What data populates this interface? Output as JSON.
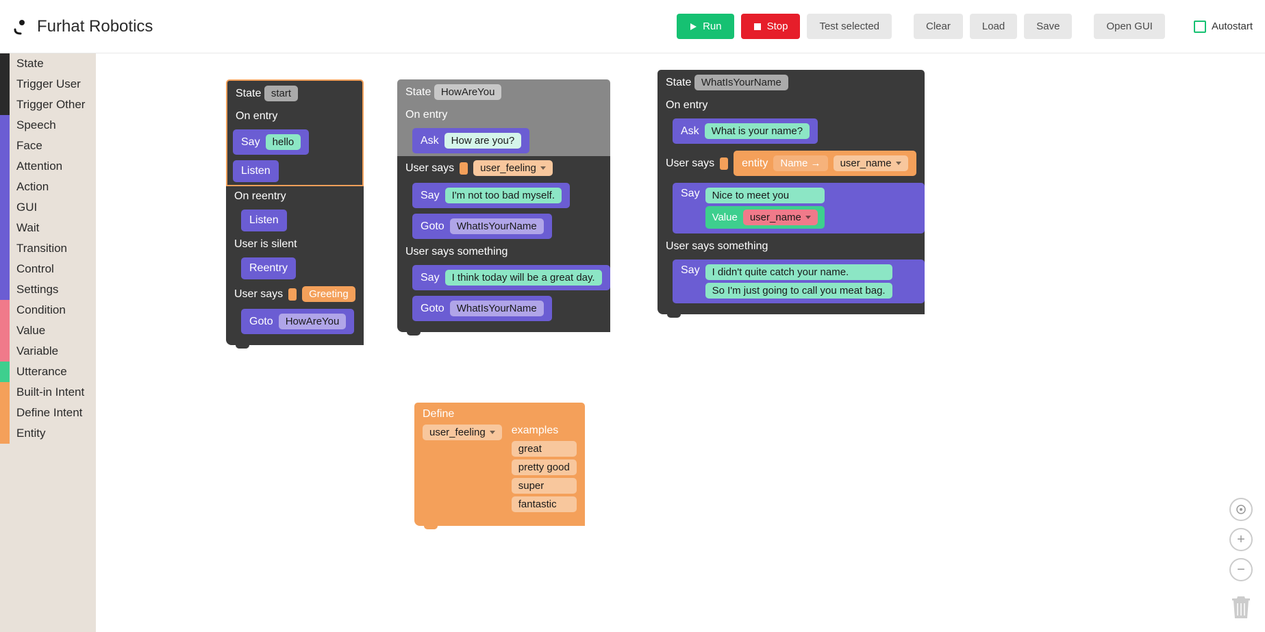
{
  "header": {
    "logo_text": "Furhat Robotics",
    "buttons": {
      "run": "Run",
      "stop": "Stop",
      "test_selected": "Test selected",
      "clear": "Clear",
      "load": "Load",
      "save": "Save",
      "open_gui": "Open GUI"
    },
    "autostart_label": "Autostart"
  },
  "sidebar": {
    "categories": [
      {
        "label": "State",
        "color": "#2a2a2a"
      },
      {
        "label": "Trigger User",
        "color": "#2a2a2a"
      },
      {
        "label": "Trigger Other",
        "color": "#2a2a2a"
      },
      {
        "label": "Speech",
        "color": "#6b5dd3"
      },
      {
        "label": "Face",
        "color": "#6b5dd3"
      },
      {
        "label": "Attention",
        "color": "#6b5dd3"
      },
      {
        "label": "Action",
        "color": "#6b5dd3"
      },
      {
        "label": "GUI",
        "color": "#6b5dd3"
      },
      {
        "label": "Wait",
        "color": "#6b5dd3"
      },
      {
        "label": "Transition",
        "color": "#6b5dd3"
      },
      {
        "label": "Control",
        "color": "#6b5dd3"
      },
      {
        "label": "Settings",
        "color": "#6b5dd3"
      },
      {
        "label": "Condition",
        "color": "#f07a8a"
      },
      {
        "label": "Value",
        "color": "#f07a8a"
      },
      {
        "label": "Variable",
        "color": "#f07a8a"
      },
      {
        "label": "Utterance",
        "color": "#3ecf8e"
      },
      {
        "label": "Built-in Intent",
        "color": "#f4a05a"
      },
      {
        "label": "Define Intent",
        "color": "#f4a05a"
      },
      {
        "label": "Entity",
        "color": "#f4a05a"
      }
    ]
  },
  "blocks": {
    "labels": {
      "state": "State",
      "on_entry": "On entry",
      "on_reentry": "On reentry",
      "user_is_silent": "User is silent",
      "user_says": "User says",
      "user_says_something": "User says something",
      "say": "Say",
      "ask": "Ask",
      "listen": "Listen",
      "reentry": "Reentry",
      "goto": "Goto",
      "entity": "entity",
      "name_arrow": "Name →",
      "value": "Value",
      "define": "Define",
      "examples": "examples"
    },
    "state1": {
      "name": "start",
      "say_hello": "hello",
      "greeting": "Greeting",
      "goto_target": "HowAreYou"
    },
    "state2": {
      "name": "HowAreYou",
      "ask_text": "How are you?",
      "user_feeling": "user_feeling",
      "say_response": "I'm not too bad myself.",
      "goto1": "WhatIsYourName",
      "say_else": "I think today will be a great day.",
      "goto2": "WhatIsYourName"
    },
    "state3": {
      "name": "WhatIsYourName",
      "ask_text": "What is your name?",
      "user_name": "user_name",
      "say_nice": "Nice to meet you",
      "value_ref": "user_name",
      "say_catch1": "I didn't quite catch your name.",
      "say_catch2": "So I'm just going to call you meat bag."
    },
    "define": {
      "intent_name": "user_feeling",
      "examples": [
        "great",
        "pretty good",
        "super",
        "fantastic"
      ]
    }
  }
}
